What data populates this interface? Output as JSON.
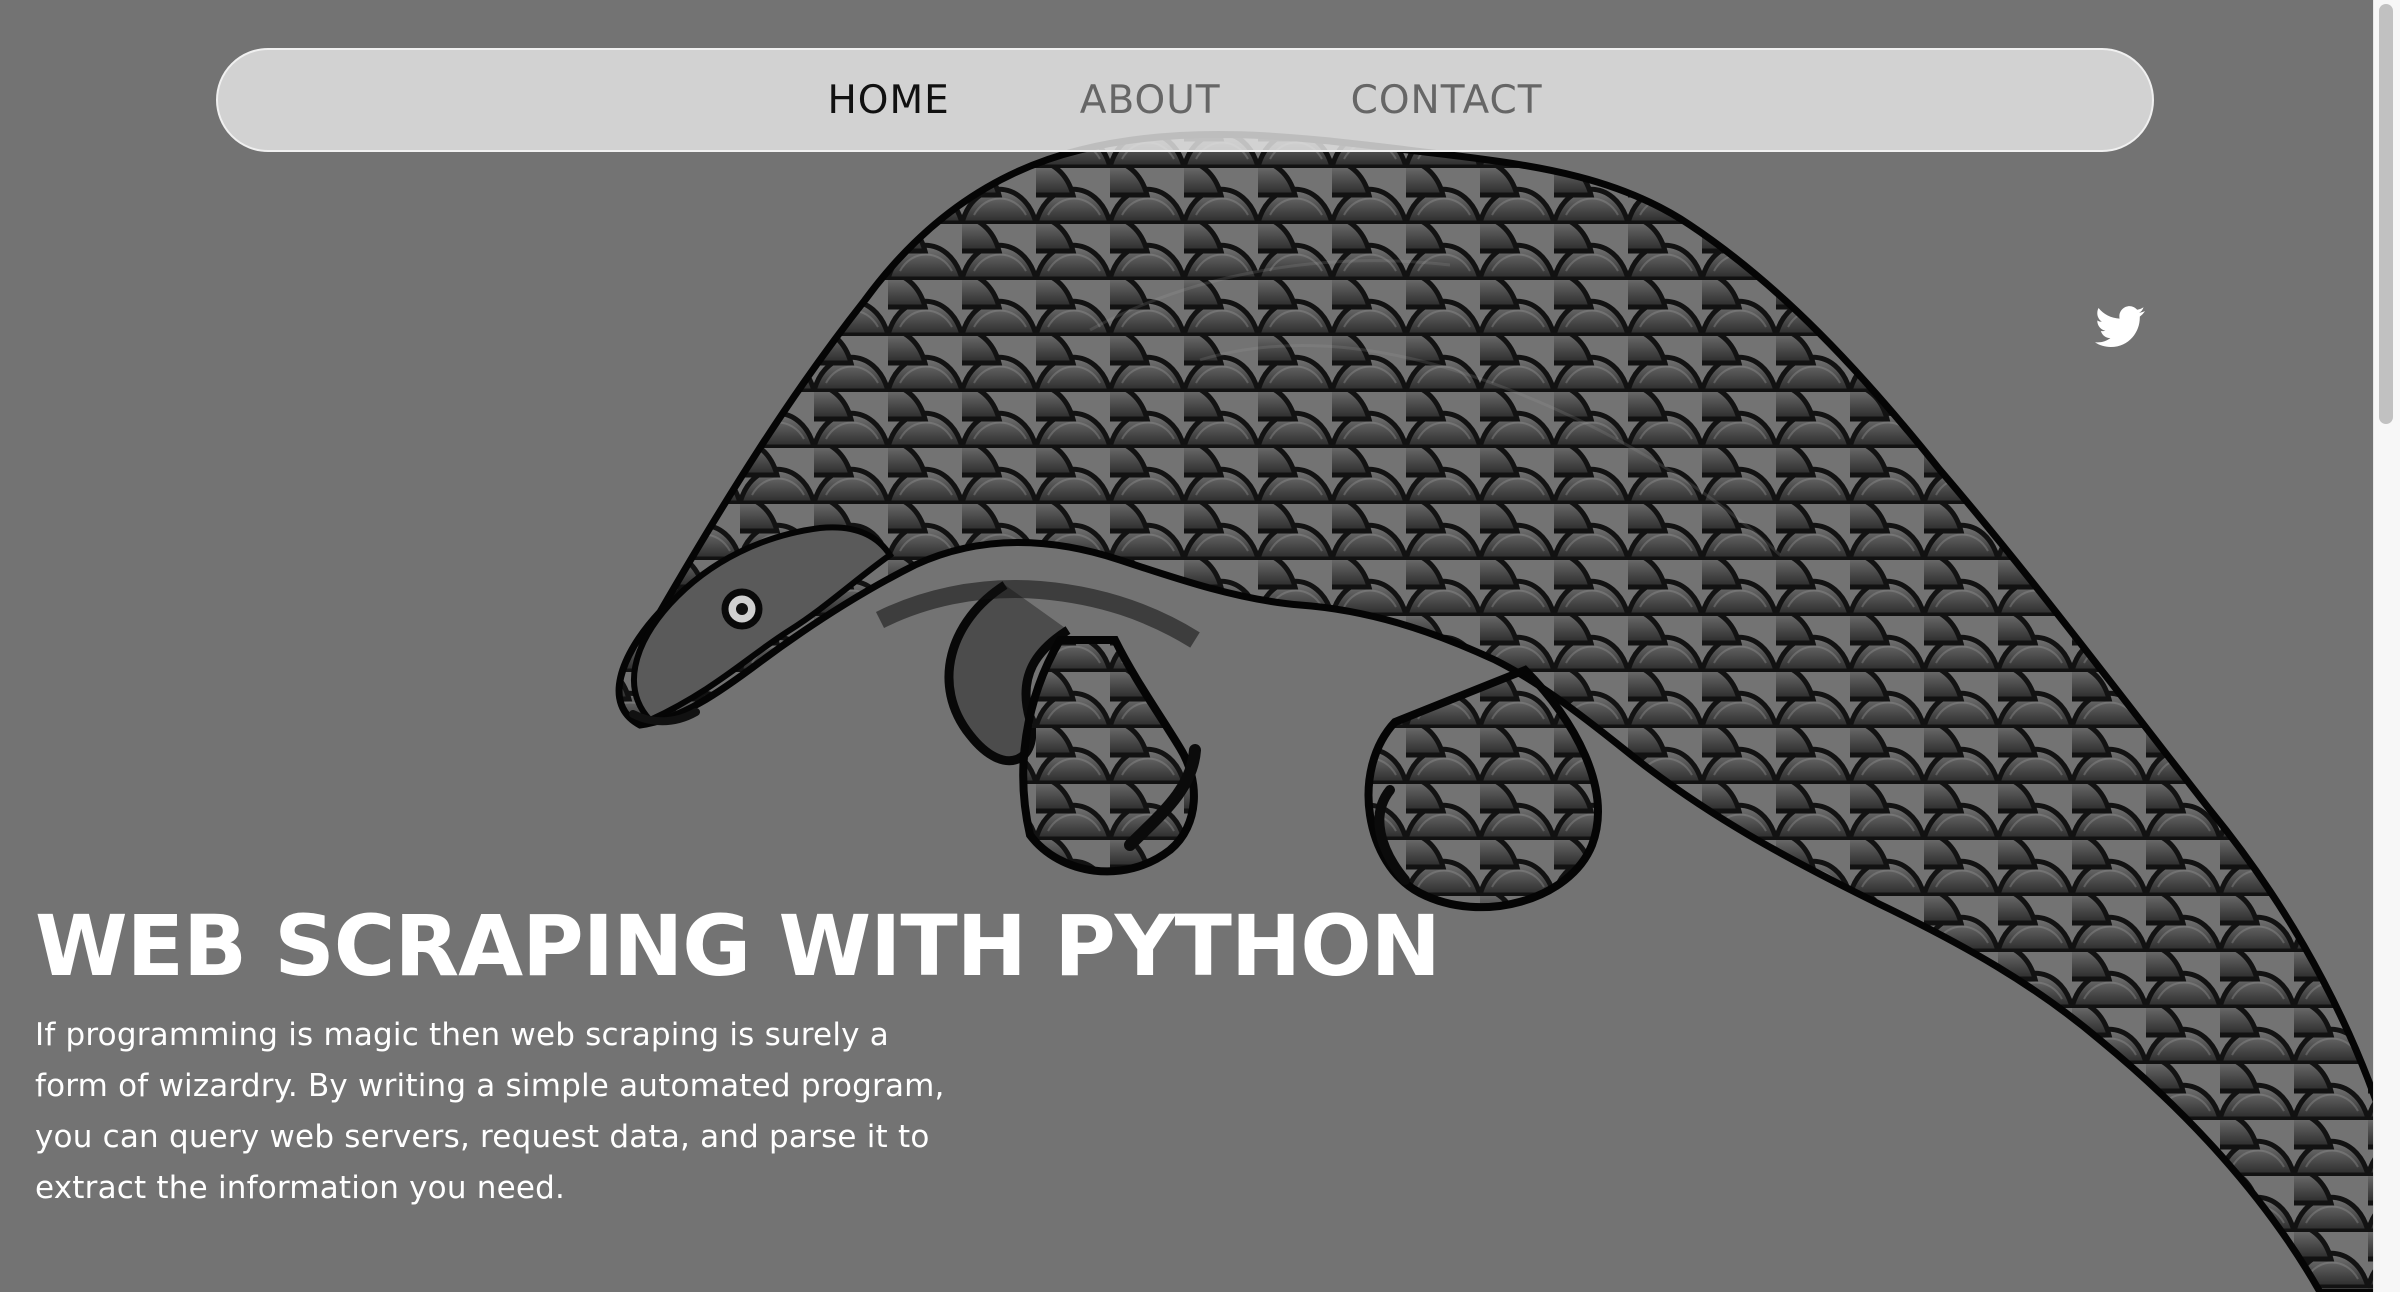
{
  "navigation": {
    "items": [
      {
        "label": "HOME",
        "active": true
      },
      {
        "label": "ABOUT",
        "active": false
      },
      {
        "label": "CONTACT",
        "active": false
      }
    ]
  },
  "social": {
    "icon": "twitter-icon"
  },
  "hero": {
    "title": "WEB SCRAPING WITH PYTHON",
    "description": "If programming is magic then web scraping is surely a form of wizardry. By writing a simple automated program, you can query web servers, request data, and parse it to extract the information you need."
  },
  "colors": {
    "background": "#737373",
    "nav_background": "#d6d6d6",
    "active_nav_text": "#111111",
    "nav_text": "#666666",
    "hero_text": "#ffffff"
  },
  "image": {
    "subject": "pangolin-illustration"
  }
}
